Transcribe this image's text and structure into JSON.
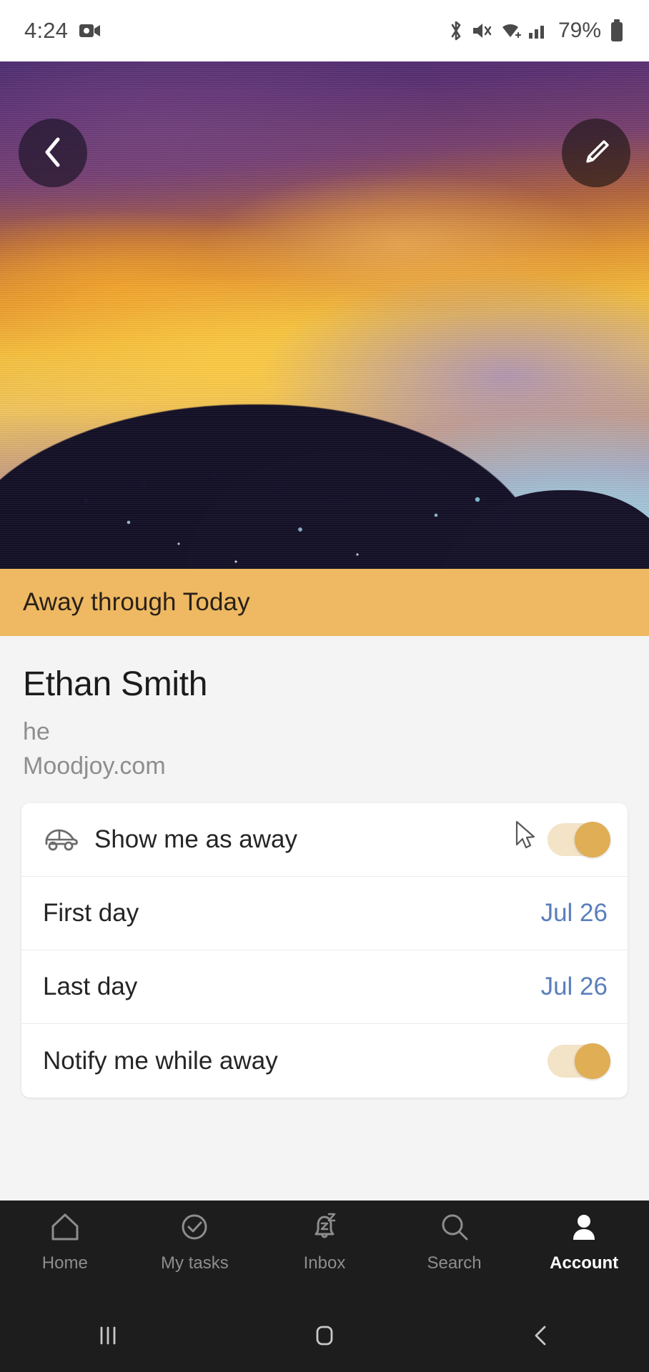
{
  "status_bar": {
    "time": "4:24",
    "battery_percent": "79%",
    "icons": [
      "screen-recorder-icon",
      "bluetooth-icon",
      "mute-icon",
      "wifi-icon",
      "cellular-signal-icon",
      "battery-icon"
    ]
  },
  "hero": {
    "back_button_label": "Back",
    "edit_button_label": "Edit profile photo",
    "image_description": "sunset-sky-with-tree-silhouette"
  },
  "away_banner": {
    "text": "Away through Today",
    "background_color": "#eeb962",
    "text_color": "#2a2118"
  },
  "profile": {
    "name": "Ethan Smith",
    "pronouns": "he",
    "website": "Moodjoy.com"
  },
  "settings": {
    "rows": [
      {
        "label": "Show me as away",
        "icon": "car-icon",
        "control": "toggle",
        "toggle_on": true,
        "value": ""
      },
      {
        "label": "First day",
        "icon": "",
        "control": "value",
        "toggle_on": false,
        "value": "Jul 26"
      },
      {
        "label": "Last day",
        "icon": "",
        "control": "value",
        "toggle_on": false,
        "value": "Jul 26"
      },
      {
        "label": "Notify me while away",
        "icon": "",
        "control": "toggle",
        "toggle_on": true,
        "value": ""
      }
    ],
    "accent_color": "#dfae55",
    "value_color": "#5a7fbc"
  },
  "bottom_nav": {
    "items": [
      {
        "label": "Home",
        "icon": "home-icon",
        "active": false
      },
      {
        "label": "My tasks",
        "icon": "check-circle-icon",
        "active": false
      },
      {
        "label": "Inbox",
        "icon": "bell-snooze-icon",
        "active": false
      },
      {
        "label": "Search",
        "icon": "search-icon",
        "active": false
      },
      {
        "label": "Account",
        "icon": "person-icon",
        "active": true
      }
    ]
  },
  "system_nav": {
    "recents_label": "Recents",
    "home_label": "Home",
    "back_label": "Back"
  }
}
